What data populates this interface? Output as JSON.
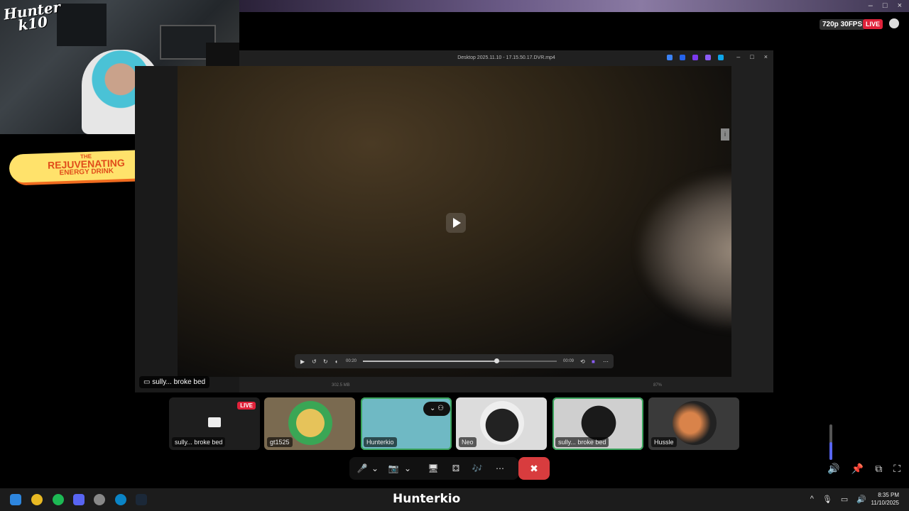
{
  "window": {
    "minimize": "–",
    "maximize": "□",
    "close": "×"
  },
  "webcam": {
    "logo_line1": "Hunter",
    "logo_line2": "k10"
  },
  "banner": {
    "line1": "THE",
    "line2": "REJUVENATING",
    "line3": "ENERGY DRINK"
  },
  "stream": {
    "quality": "720p 30FPS",
    "live": "LIVE"
  },
  "player": {
    "title": "Desktop 2025.11.10 - 17.15.50.17.DVR.mp4",
    "tab_colors": [
      "#3b82f6",
      "#2563eb",
      "#7c3aed",
      "#8b5cf6",
      "#0ea5e9"
    ],
    "time_current": "00:20",
    "time_total": "00:09",
    "progress": 0.69,
    "file_size": "302.5 MB",
    "zoom": "87%"
  },
  "caption": {
    "text": "sully... broke bed"
  },
  "tiles": [
    {
      "name": "sully... broke bed",
      "live": "LIVE",
      "bg": "#1e1e1e"
    },
    {
      "name": "gt1525",
      "bg": "#7a6a50"
    },
    {
      "name": "Hunterkio",
      "bg": "#6fb9c4"
    },
    {
      "name": "Neo",
      "bg": "#dcdcdc"
    },
    {
      "name": "sully... broke bed",
      "bg": "#cfcfcf"
    },
    {
      "name": "Hussle",
      "bg": "#3a3a3a"
    }
  ],
  "callbar": {
    "mic": "🎤",
    "chev": "⌄",
    "camera": "📷",
    "screen": "🖥",
    "activities": "⚃",
    "soundboard": "🎶",
    "more": "⋯",
    "hangup": "✖"
  },
  "right_icons": {
    "volume": "🔊",
    "pin": "📌",
    "popout": "⧉",
    "fullscreen": "⛶"
  },
  "volume_level": 0.5,
  "taskbar": {
    "brand": "Hunterkio",
    "app_colors": [
      "#2e86de",
      "#e8b923",
      "#1db954",
      "#5865f2",
      "#888888",
      "#0a84c6",
      "#1b2838"
    ],
    "tray_up": "^",
    "tray_mic": "🎙",
    "tray_net": "▭",
    "tray_vol": "🔊",
    "time": "8:35 PM",
    "date": "11/10/2025"
  }
}
